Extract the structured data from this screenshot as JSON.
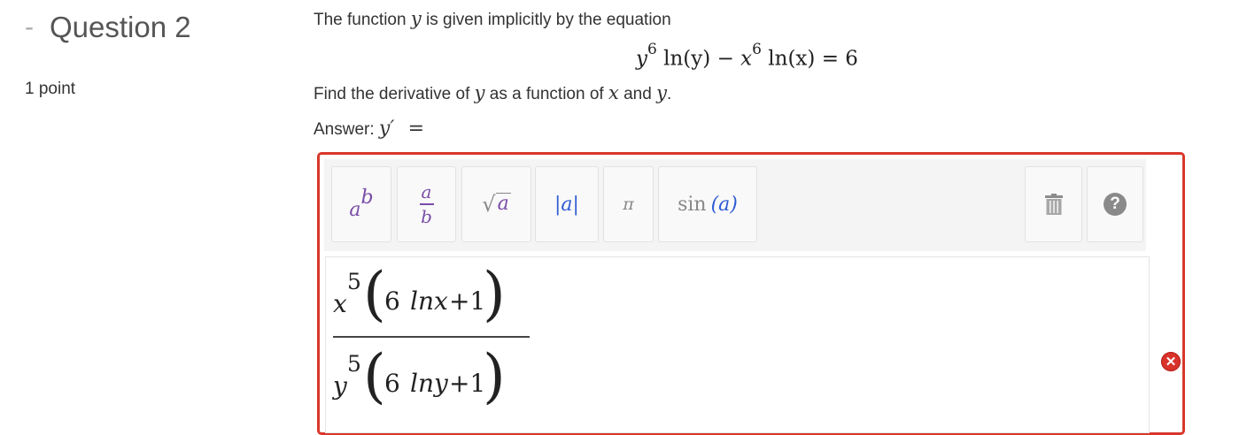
{
  "question": {
    "dash": "-",
    "title": "Question 2",
    "points": "1 point"
  },
  "prompt": {
    "line1_a": "The function ",
    "line1_var": "y",
    "line1_b": " is given implicitly by the equation",
    "eq_y": "y",
    "eq_exp1": "6",
    "eq_ln_y": "ln(y)",
    "eq_minus": "−",
    "eq_x": "x",
    "eq_exp2": "6",
    "eq_ln_x": "ln(x)",
    "eq_rhs": "= 6",
    "find_a": "Find the derivative of ",
    "find_y": "y",
    "find_b": " as a function of ",
    "find_x": "x",
    "find_c": " and ",
    "find_y2": "y",
    "find_d": ".",
    "answer_label": "Answer: ",
    "answer_var": "y′",
    "answer_eq": "="
  },
  "toolbar": {
    "power_base": "a",
    "power_exp": "b",
    "frac_num": "a",
    "frac_den": "b",
    "sqrt_sym": "√",
    "sqrt_arg": "a",
    "abs_label": "|a|",
    "pi_label": "π",
    "sin_fn": "sin",
    "sin_arg": "(a)",
    "trash_icon": "trash-icon",
    "help_icon": "help-icon",
    "help_glyph": "?"
  },
  "entry": {
    "num_var": "x",
    "num_exp": "5",
    "num_six": "6",
    "num_ln": "lnx",
    "num_plus": "+1",
    "den_var": "y",
    "den_exp": "5",
    "den_six": "6",
    "den_ln": "lny",
    "den_plus": "+1"
  },
  "status": {
    "error_glyph": "✕",
    "error_color": "#d8322a"
  }
}
